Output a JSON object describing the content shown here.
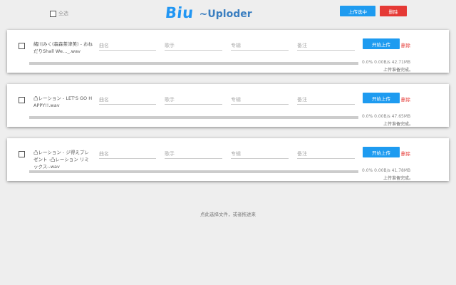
{
  "header": {
    "select_all_label": "全选",
    "logo_main": "Biu",
    "logo_sub": "~Uploder",
    "uploading_button": "上传选中",
    "delete_button": "删除"
  },
  "files": [
    {
      "filename": "緒川みく(森森茶津美) - おねだりShall We…_.wav",
      "title_placeholder": "曲名",
      "artist_placeholder": "歌手",
      "album_placeholder": "专辑",
      "note_placeholder": "备注",
      "upload_label": "开始上传",
      "delete_label": "删除",
      "progress": 0,
      "progress_text": "0.0% 0.00B/s 42.71MB",
      "status": "上传准备完成。"
    },
    {
      "filename": "凸レーション - LET'S GO HAPPY!!.wav",
      "title_placeholder": "曲名",
      "artist_placeholder": "歌手",
      "album_placeholder": "专辑",
      "note_placeholder": "备注",
      "upload_label": "开始上传",
      "delete_label": "删除",
      "progress": 0,
      "progress_text": "0.0% 0.00B/s 47.65MB",
      "status": "上传准备完成。"
    },
    {
      "filename": "凸レーション - ジ得えプレゼント -凸レーション リミックス-.wav",
      "title_placeholder": "曲名",
      "artist_placeholder": "歌手",
      "album_placeholder": "专辑",
      "note_placeholder": "备注",
      "upload_label": "开始上传",
      "delete_label": "删除",
      "progress": 0,
      "progress_text": "0.0% 0.00B/s 41.78MB",
      "status": "上传准备完成。"
    }
  ],
  "footer": {
    "hint": "点此选择文件，或者拖进来"
  },
  "colors": {
    "accent": "#1e9bf0",
    "danger": "#e53935",
    "logo": "#2196f3"
  }
}
